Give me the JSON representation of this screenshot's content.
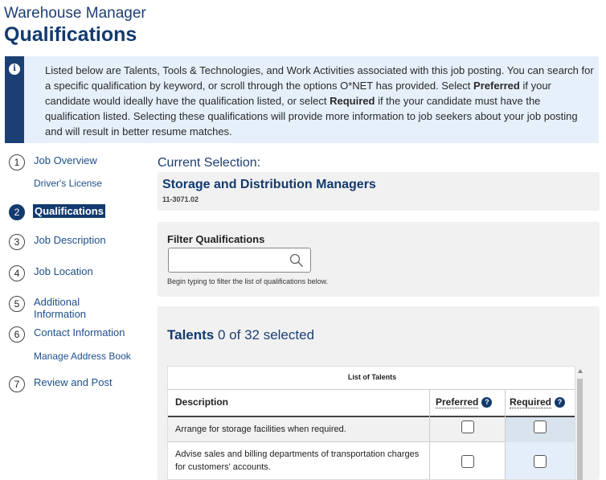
{
  "header": {
    "subtitle": "Warehouse Manager",
    "title": "Qualifications"
  },
  "info": {
    "icon": "info-icon",
    "text_1": "Listed below are Talents, Tools & Technologies, and Work Activities associated with this job posting. You can search for a specific qualification by keyword, or scroll through the options O*NET has provided. Select ",
    "preferred": "Preferred",
    "text_2": " if your candidate would ideally have the qualification listed, or select ",
    "required": "Required",
    "text_3": " if the your candidate must have the qualification listed. Selecting these qualifications will provide more information to job seekers about your job posting and will result in better resume matches."
  },
  "nav": {
    "steps": [
      {
        "num": "1",
        "label": "Job Overview"
      },
      {
        "num": "2",
        "label": "Qualifications"
      },
      {
        "num": "3",
        "label": "Job Description"
      },
      {
        "num": "4",
        "label": "Job Location"
      },
      {
        "num": "5",
        "label": "Additional Information"
      },
      {
        "num": "6",
        "label": "Contact Information"
      },
      {
        "num": "7",
        "label": "Review and Post"
      }
    ],
    "sub_driver": "Driver's License",
    "sub_address": "Manage Address Book"
  },
  "current": {
    "label": "Current Selection:",
    "occupation": "Storage and Distribution Managers",
    "code": "11-3071.02"
  },
  "filter": {
    "label": "Filter Qualifications",
    "value": "",
    "help": "Begin typing to filter the list of qualifications below."
  },
  "talents": {
    "heading": "Talents",
    "count_text": " 0 of 32 selected",
    "caption": "List of Talents",
    "col_description": "Description",
    "col_preferred": "Preferred",
    "col_required": "Required",
    "help_glyph": "?",
    "rows": [
      {
        "description": "Arrange for storage facilities when required."
      },
      {
        "description": "Advise sales and billing departments of transportation charges for customers' accounts."
      }
    ]
  },
  "colors": {
    "brand": "#123a6e",
    "info_bg": "#e6f0fb",
    "panel_bg": "#f1f1f1",
    "required_col_bg": "#e4eefa"
  }
}
